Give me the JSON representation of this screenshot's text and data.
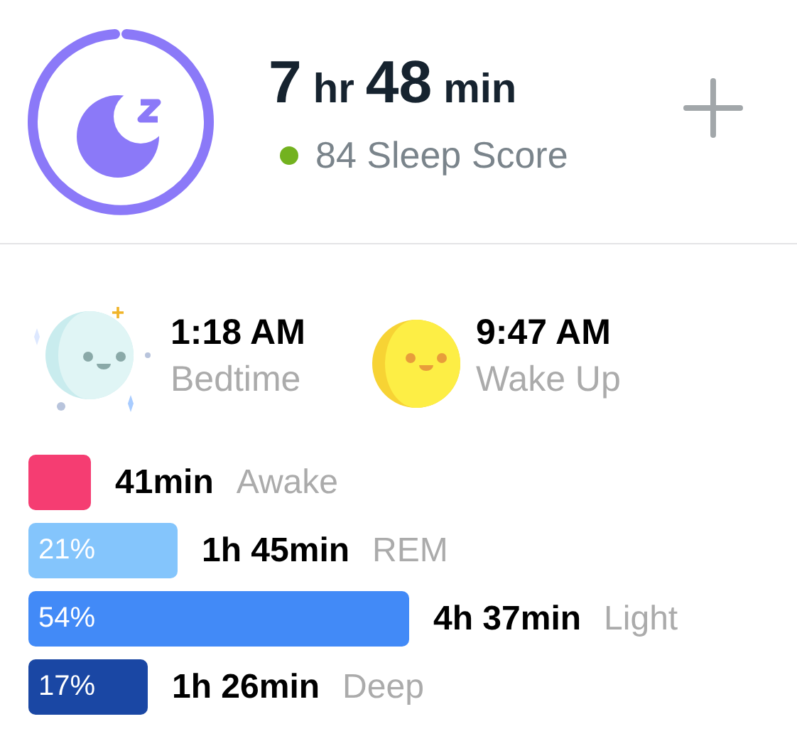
{
  "summary": {
    "hours": "7",
    "hours_unit": "hr",
    "minutes": "48",
    "minutes_unit": "min",
    "score": "84 Sleep Score"
  },
  "times": [
    {
      "kind": "bedtime",
      "time": "1:18 AM",
      "label": "Bedtime"
    },
    {
      "kind": "wake",
      "time": "9:47 AM",
      "label": "Wake Up"
    }
  ],
  "stages": [
    {
      "duration": "41min",
      "label": "Awake",
      "color": "#f53d72"
    },
    {
      "percent": "21%",
      "duration": "1h 45min",
      "label": "REM",
      "color": "#84c5fc"
    },
    {
      "percent": "54%",
      "duration": "4h 37min",
      "label": "Light",
      "color": "#428af7"
    },
    {
      "percent": "17%",
      "duration": "1h 26min",
      "label": "Deep",
      "color": "#1a47a4"
    }
  ]
}
